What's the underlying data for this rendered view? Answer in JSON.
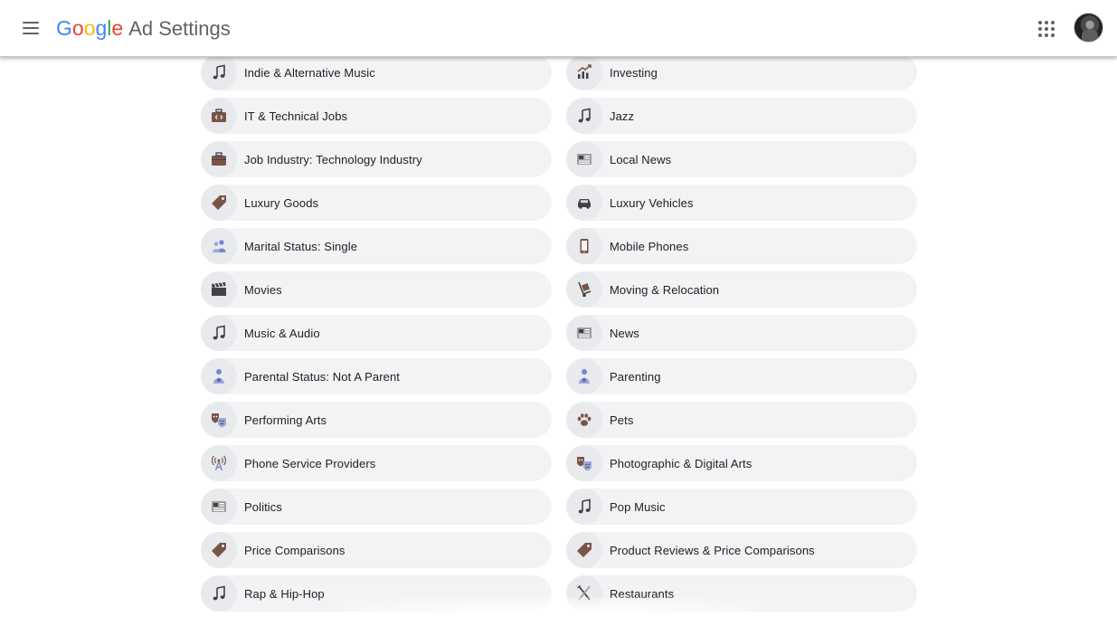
{
  "header": {
    "logo_letters": [
      {
        "ch": "G",
        "color": "#4285F4"
      },
      {
        "ch": "o",
        "color": "#EA4335"
      },
      {
        "ch": "o",
        "color": "#FBBC05"
      },
      {
        "ch": "g",
        "color": "#4285F4"
      },
      {
        "ch": "l",
        "color": "#34A853"
      },
      {
        "ch": "e",
        "color": "#EA4335"
      }
    ],
    "logo_text": "Google",
    "product": "Ad Settings",
    "menu_icon": "hamburger-menu-icon",
    "apps_icon": "apps-grid-icon",
    "avatar_label": "account-avatar"
  },
  "topics": [
    {
      "label": "Indie & Alternative Music",
      "icon": "music-note"
    },
    {
      "label": "Investing",
      "icon": "chart-up"
    },
    {
      "label": "IT & Technical Jobs",
      "icon": "briefcase-code"
    },
    {
      "label": "Jazz",
      "icon": "music-note"
    },
    {
      "label": "Job Industry: Technology Industry",
      "icon": "briefcase"
    },
    {
      "label": "Local News",
      "icon": "newspaper"
    },
    {
      "label": "Luxury Goods",
      "icon": "price-tag"
    },
    {
      "label": "Luxury Vehicles",
      "icon": "car"
    },
    {
      "label": "Marital Status: Single",
      "icon": "person-group"
    },
    {
      "label": "Mobile Phones",
      "icon": "mobile-phone"
    },
    {
      "label": "Movies",
      "icon": "clapperboard"
    },
    {
      "label": "Moving & Relocation",
      "icon": "hand-truck"
    },
    {
      "label": "Music & Audio",
      "icon": "music-note"
    },
    {
      "label": "News",
      "icon": "newspaper"
    },
    {
      "label": "Parental Status: Not A Parent",
      "icon": "person-baby"
    },
    {
      "label": "Parenting",
      "icon": "person-baby"
    },
    {
      "label": "Performing Arts",
      "icon": "theater-masks"
    },
    {
      "label": "Pets",
      "icon": "paw"
    },
    {
      "label": "Phone Service Providers",
      "icon": "antenna-tower"
    },
    {
      "label": "Photographic & Digital Arts",
      "icon": "theater-masks"
    },
    {
      "label": "Politics",
      "icon": "newspaper"
    },
    {
      "label": "Pop Music",
      "icon": "music-note"
    },
    {
      "label": "Price Comparisons",
      "icon": "price-tag"
    },
    {
      "label": "Product Reviews & Price Comparisons",
      "icon": "price-tag"
    },
    {
      "label": "Rap & Hip-Hop",
      "icon": "music-note"
    },
    {
      "label": "Restaurants",
      "icon": "fork-knife"
    }
  ],
  "colors": {
    "chip_bg": "#f1f3f4",
    "icon_bg": "#e8eaed",
    "icon_brown": "#795548",
    "icon_dark": "#424242",
    "text": "#202124",
    "product_gray": "#5f6368"
  }
}
